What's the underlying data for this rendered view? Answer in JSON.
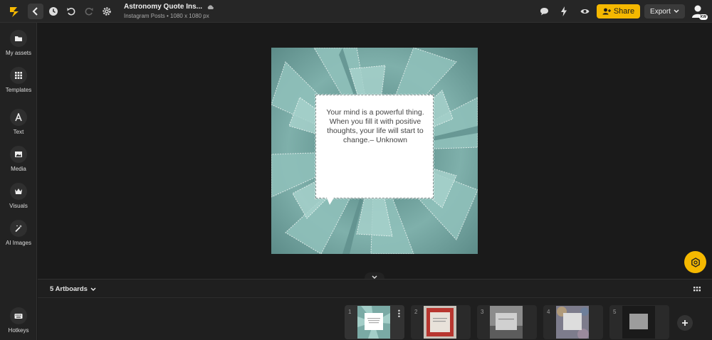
{
  "header": {
    "title": "Astronomy Quote Ins...",
    "subtitle": "Instagram Posts • 1080 x 1080 px",
    "share_label": "Share",
    "export_label": "Export",
    "avatar_initials": "KW"
  },
  "sidebar": {
    "items": [
      {
        "label": "My assets",
        "icon": "folder-icon"
      },
      {
        "label": "Templates",
        "icon": "grid-icon"
      },
      {
        "label": "Text",
        "icon": "text-icon"
      },
      {
        "label": "Media",
        "icon": "image-icon"
      },
      {
        "label": "Visuals",
        "icon": "crown-icon"
      },
      {
        "label": "AI Images",
        "icon": "magic-wand-icon"
      }
    ],
    "hotkeys_label": "Hotkeys"
  },
  "canvas": {
    "quote": "Your mind is a powerful thing. When you fill it with positive thoughts, your life will start to change.– Unknown"
  },
  "bottom": {
    "artboards_label": "5 Artboards",
    "thumbnails": [
      {
        "number": "1"
      },
      {
        "number": "2"
      },
      {
        "number": "3"
      },
      {
        "number": "4"
      },
      {
        "number": "5"
      }
    ]
  },
  "colors": {
    "accent": "#f5b800",
    "background": "#1a1a1a",
    "panel": "#222222"
  }
}
